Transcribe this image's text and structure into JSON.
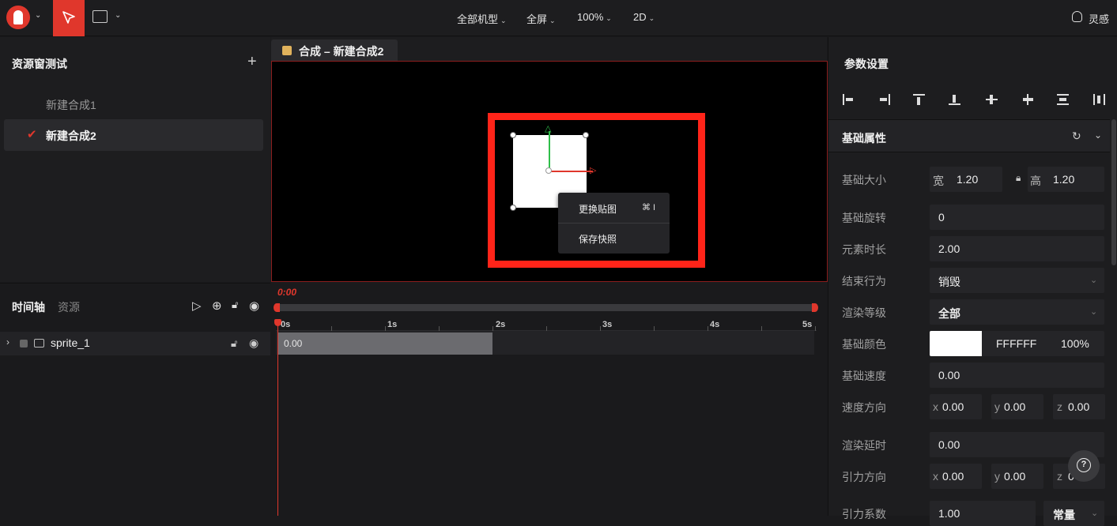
{
  "topbar": {
    "menus": [
      {
        "label": "全部机型"
      },
      {
        "label": "全屏"
      },
      {
        "label": "100%"
      },
      {
        "label": "2D"
      }
    ],
    "inspire_label": "灵感"
  },
  "assets": {
    "title": "资源窗测试",
    "items": [
      {
        "label": "新建合成1"
      },
      {
        "label": "新建合成2"
      }
    ]
  },
  "editor": {
    "tab_label": "合成 – 新建合成2",
    "context_menu": {
      "items": [
        {
          "label": "更换贴图",
          "shortcut": "⌘ I"
        },
        {
          "label": "保存快照"
        }
      ]
    }
  },
  "timeline": {
    "tabs": [
      {
        "label": "时间轴"
      },
      {
        "label": "资源"
      }
    ],
    "current_time": "0:00",
    "ticks": [
      "0s",
      "1s",
      "2s",
      "3s",
      "4s",
      "5s"
    ],
    "tracks": [
      {
        "name": "sprite_1",
        "clip_label": "0.00"
      }
    ]
  },
  "properties": {
    "title": "参数设置",
    "section_title": "基础属性",
    "size": {
      "label": "基础大小",
      "width_prefix": "宽",
      "width": "1.20",
      "height_prefix": "高",
      "height": "1.20"
    },
    "rotation": {
      "label": "基础旋转",
      "value": "0"
    },
    "duration": {
      "label": "元素时长",
      "value": "2.00"
    },
    "end_behavior": {
      "label": "结束行为",
      "value": "销毁"
    },
    "render_level": {
      "label": "渲染等级",
      "value": "全部"
    },
    "color": {
      "label": "基础颜色",
      "hex": "FFFFFF",
      "opacity": "100%"
    },
    "speed": {
      "label": "基础速度",
      "value": "0.00"
    },
    "speed_dir": {
      "label": "速度方向",
      "x": "0.00",
      "y": "0.00",
      "z": "0.00"
    },
    "render_delay": {
      "label": "渲染延时",
      "value": "0.00"
    },
    "gravity_dir": {
      "label": "引力方向",
      "x": "0.00",
      "y": "0.00",
      "z": "0"
    },
    "gravity_coef": {
      "label": "引力系数",
      "value": "1.00",
      "mode": "常量"
    }
  },
  "colors": {
    "accent": "#e0372c",
    "canvas_bg": "#000000",
    "highlight_frame": "#ff2419"
  }
}
